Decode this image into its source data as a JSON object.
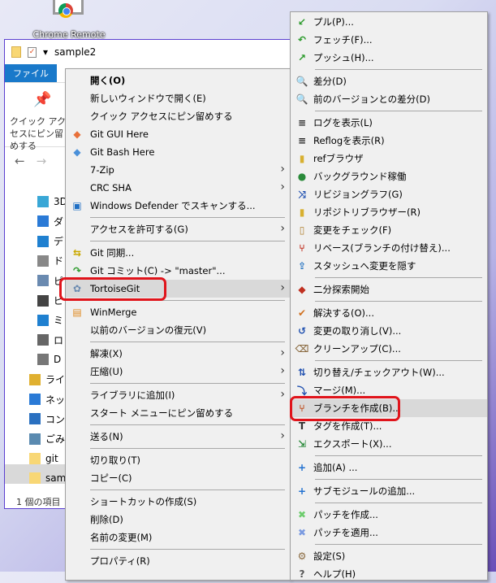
{
  "desktop": {
    "icon_label": "Chrome Remote"
  },
  "explorer": {
    "title": "sample2",
    "file_tab": "ファイル",
    "pin_label": "クイック アクセスにピン留めする",
    "tree": [
      "3D",
      "ダ",
      "デ",
      "ド",
      "ピ",
      "ビ",
      "ミ",
      "ロ",
      "D",
      "ライ",
      "ネッ",
      "コン",
      "ごみ",
      "git",
      "sam"
    ],
    "status": "1 個の項目"
  },
  "left_menu": [
    {
      "label": "開く(O)",
      "bold": true
    },
    {
      "label": "新しいウィンドウで開く(E)"
    },
    {
      "label": "クイック アクセスにピン留めする"
    },
    {
      "label": "Git GUI Here",
      "icon": "git-gui-icon"
    },
    {
      "label": "Git Bash Here",
      "icon": "git-bash-icon"
    },
    {
      "label": "7-Zip",
      "sub": true
    },
    {
      "label": "CRC SHA",
      "sub": true
    },
    {
      "label": "Windows Defender でスキャンする...",
      "icon": "windows-defender-icon"
    },
    {
      "sep": true
    },
    {
      "label": "アクセスを許可する(G)",
      "sub": true
    },
    {
      "sep": true
    },
    {
      "label": "Git 同期...",
      "icon": "git-sync-icon"
    },
    {
      "label": "Git コミット(C) -> \"master\"...",
      "icon": "git-commit-icon"
    },
    {
      "label": "TortoiseGit",
      "icon": "tortoisegit-icon",
      "sub": true,
      "hl": true
    },
    {
      "sep": true
    },
    {
      "label": "WinMerge",
      "icon": "winmerge-icon"
    },
    {
      "label": "以前のバージョンの復元(V)"
    },
    {
      "sep": true
    },
    {
      "label": "解凍(X)",
      "sub": true
    },
    {
      "label": "圧縮(U)",
      "sub": true
    },
    {
      "sep": true
    },
    {
      "label": "ライブラリに追加(I)",
      "sub": true
    },
    {
      "label": "スタート メニューにピン留めする"
    },
    {
      "sep": true
    },
    {
      "label": "送る(N)",
      "sub": true
    },
    {
      "sep": true
    },
    {
      "label": "切り取り(T)"
    },
    {
      "label": "コピー(C)"
    },
    {
      "sep": true
    },
    {
      "label": "ショートカットの作成(S)"
    },
    {
      "label": "削除(D)"
    },
    {
      "label": "名前の変更(M)"
    },
    {
      "sep": true
    },
    {
      "label": "プロパティ(R)"
    }
  ],
  "right_menu": [
    {
      "label": "プル(P)...",
      "icon": "pull-icon"
    },
    {
      "label": "フェッチ(F)...",
      "icon": "fetch-icon"
    },
    {
      "label": "プッシュ(H)...",
      "icon": "push-icon"
    },
    {
      "sep": true
    },
    {
      "label": "差分(D)",
      "icon": "diff-icon"
    },
    {
      "label": "前のバージョンとの差分(D)",
      "icon": "diff-prev-icon"
    },
    {
      "sep": true
    },
    {
      "label": "ログを表示(L)",
      "icon": "log-icon"
    },
    {
      "label": "Reflogを表示(R)",
      "icon": "reflog-icon"
    },
    {
      "label": "refブラウザ",
      "icon": "ref-browser-icon"
    },
    {
      "label": "バックグラウンド稼働",
      "icon": "background-icon"
    },
    {
      "label": "リビジョングラフ(G)",
      "icon": "revision-graph-icon"
    },
    {
      "label": "リポジトリブラウザー(R)",
      "icon": "repo-browser-icon"
    },
    {
      "label": "変更をチェック(F)",
      "icon": "check-modifications-icon"
    },
    {
      "label": "リベース(ブランチの付け替え)...",
      "icon": "rebase-icon"
    },
    {
      "label": "スタッシュへ変更を隠す",
      "icon": "stash-icon"
    },
    {
      "sep": true
    },
    {
      "label": "二分探索開始",
      "icon": "bisect-icon"
    },
    {
      "sep": true
    },
    {
      "label": "解決する(O)...",
      "icon": "resolve-icon"
    },
    {
      "label": "変更の取り消し(V)...",
      "icon": "revert-icon"
    },
    {
      "label": "クリーンアップ(C)...",
      "icon": "cleanup-icon"
    },
    {
      "sep": true
    },
    {
      "label": "切り替え/チェックアウト(W)...",
      "icon": "switch-icon"
    },
    {
      "label": "マージ(M)...",
      "icon": "merge-icon"
    },
    {
      "label": "ブランチを作成(B)...",
      "icon": "create-branch-icon",
      "hl": true
    },
    {
      "label": "タグを作成(T)...",
      "icon": "tag-icon"
    },
    {
      "label": "エクスポート(X)...",
      "icon": "export-icon"
    },
    {
      "sep": true
    },
    {
      "label": "追加(A) ...",
      "icon": "add-icon"
    },
    {
      "sep": true
    },
    {
      "label": "サブモジュールの追加...",
      "icon": "add-submodule-icon"
    },
    {
      "sep": true
    },
    {
      "label": "パッチを作成...",
      "icon": "create-patch-icon"
    },
    {
      "label": "パッチを適用...",
      "icon": "apply-patch-icon"
    },
    {
      "sep": true
    },
    {
      "label": "設定(S)",
      "icon": "settings-icon"
    },
    {
      "label": "ヘルプ(H)",
      "icon": "help-icon"
    }
  ]
}
